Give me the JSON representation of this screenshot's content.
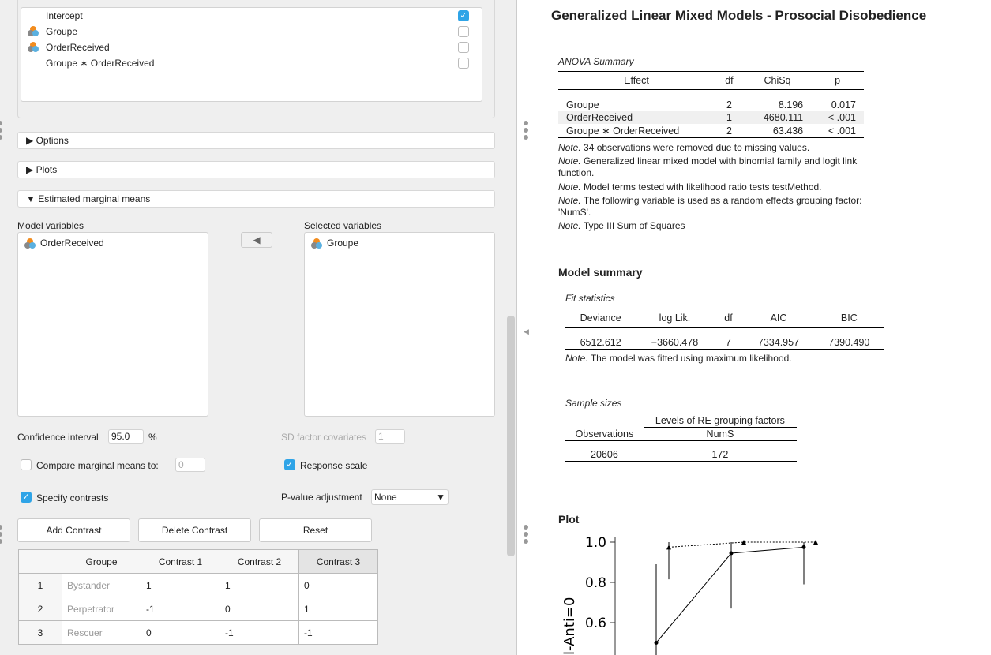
{
  "terms": {
    "items": [
      {
        "label": "Intercept",
        "checked": true,
        "icon": ""
      },
      {
        "label": "Groupe",
        "checked": false,
        "icon": "nominal-variable-icon"
      },
      {
        "label": "OrderReceived",
        "checked": false,
        "icon": "nominal-variable-icon"
      },
      {
        "label": "Groupe ∗ OrderReceived",
        "checked": false,
        "icon": ""
      }
    ]
  },
  "sections": {
    "options": "Options",
    "plots": "Plots",
    "emm": "Estimated marginal means"
  },
  "emm": {
    "model_vars_label": "Model variables",
    "model_vars": [
      "OrderReceived"
    ],
    "selected_vars_label": "Selected variables",
    "selected_vars": [
      "Groupe"
    ],
    "ci_label": "Confidence interval",
    "ci_value": "95.0",
    "ci_unit": "%",
    "sd_label": "SD factor covariates",
    "sd_value": "1",
    "compare_label": "Compare marginal means to:",
    "compare_value": "0",
    "response_label": "Response scale",
    "specify_label": "Specify contrasts",
    "padj_label": "P-value adjustment",
    "padj_value": "None",
    "add": "Add Contrast",
    "delete": "Delete Contrast",
    "reset": "Reset",
    "contrast_headers": [
      "",
      "Groupe",
      "Contrast 1",
      "Contrast 2",
      "Contrast 3"
    ],
    "contrast_rows": [
      [
        "1",
        "Bystander",
        "1",
        "1",
        "0"
      ],
      [
        "2",
        "Perpetrator",
        "-1",
        "0",
        "1"
      ],
      [
        "3",
        "Rescuer",
        "0",
        "-1",
        "-1"
      ]
    ]
  },
  "results": {
    "title": "Generalized Linear Mixed Models - Prosocial Disobedience",
    "anova": {
      "caption": "ANOVA Summary",
      "headers": [
        "Effect",
        "df",
        "ChiSq",
        "p"
      ],
      "rows": [
        [
          "Groupe",
          "2",
          "8.196",
          "0.017"
        ],
        [
          "OrderReceived",
          "1",
          "4680.111",
          "< .001"
        ],
        [
          "Groupe ∗ OrderReceived",
          "2",
          "63.436",
          "< .001"
        ]
      ],
      "notes": [
        "34 observations were removed due to missing values.",
        "Generalized linear mixed model with binomial family and logit link function.",
        "Model terms tested with likelihood ratio tests testMethod.",
        "The following variable is used as a random effects grouping factor: 'NumS'.",
        "Type III Sum of Squares"
      ],
      "note_label": "Note."
    },
    "model_summary": "Model summary",
    "fit": {
      "caption": "Fit statistics",
      "headers": [
        "Deviance",
        "log Lik.",
        "df",
        "AIC",
        "BIC"
      ],
      "row": [
        "6512.612",
        "−3660.478",
        "7",
        "7334.957",
        "7390.490"
      ],
      "note": "The model was fitted using maximum likelihood."
    },
    "sample": {
      "caption": "Sample sizes",
      "group_header": "Levels of RE grouping factors",
      "headers": [
        "Observations",
        "NumS"
      ],
      "row": [
        "20606",
        "172"
      ]
    },
    "plot_title": "Plot"
  },
  "chart_data": {
    "type": "line",
    "ylabel": "l-Anti=0",
    "yticks": [
      "1.0",
      "0.8",
      "0.6"
    ],
    "ylim": [
      0.45,
      1.0
    ],
    "series": [
      {
        "style": "solid",
        "marker": "circle",
        "values": [
          0.5,
          0.945,
          0.975
        ],
        "ci": [
          [
            0.4,
            0.89
          ],
          [
            0.67,
            1.0
          ],
          [
            0.79,
            1.0
          ]
        ]
      },
      {
        "style": "dotted",
        "marker": "triangle",
        "values": [
          0.975,
          1.0,
          1.0
        ],
        "ci": [
          [
            0.815,
            1.0
          ],
          [
            1.0,
            1.0
          ],
          [
            1.0,
            1.0
          ]
        ]
      }
    ]
  },
  "colors": {
    "accent": "#2fa4e7"
  }
}
